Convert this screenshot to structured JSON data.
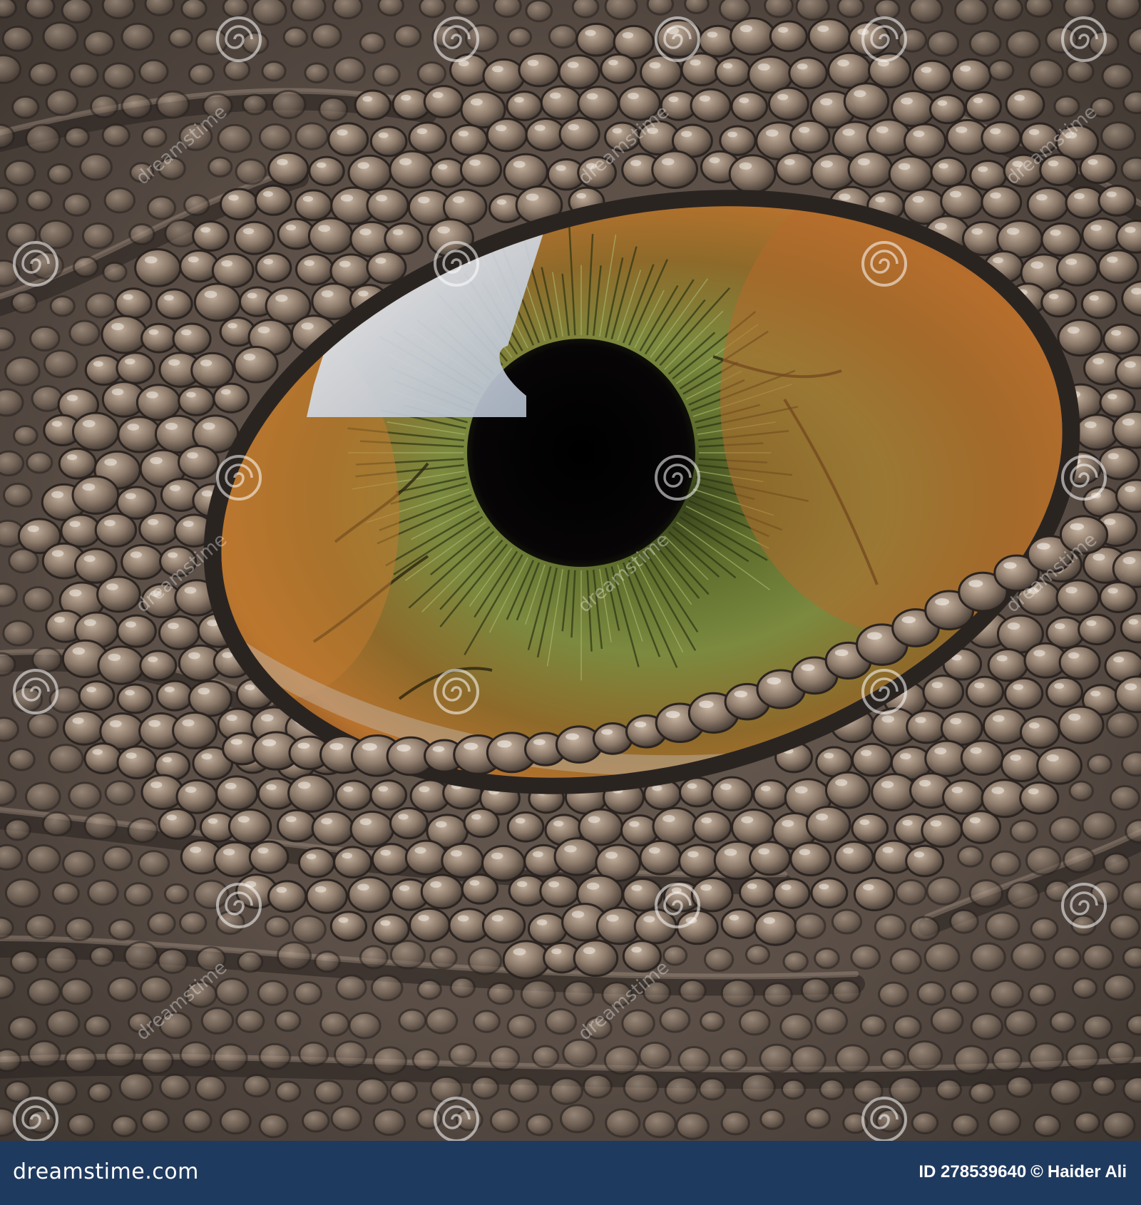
{
  "image": {
    "subject": "reptile-eye-closeup",
    "colors": {
      "skin_dark": "#3f3a36",
      "skin_mid": "#7d6e62",
      "skin_light": "#a89685",
      "iris_green": "#6f7c3c",
      "iris_orange": "#b9732e",
      "pupil": "#050405",
      "highlight": "#dfe6ef"
    }
  },
  "watermark": {
    "icon": "spiral-watermark-icon",
    "text": "dreamstime"
  },
  "footer": {
    "site": "dreamstime.com",
    "id_text": "ID 278539640",
    "copyright_symbol": "©",
    "author": "Haider Ali",
    "background": "#1f3a5f"
  }
}
